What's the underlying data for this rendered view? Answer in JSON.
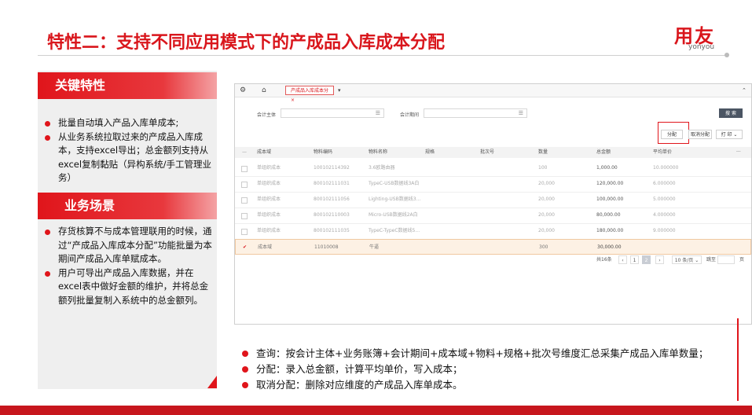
{
  "slide": {
    "title": "特性二：支持不同应用模式下的产成品入库成本分配",
    "logo_cn": "用友",
    "logo_en": "yonyou"
  },
  "key_features": {
    "header": "关键特性",
    "items": [
      "批量自动填入产品入库单成本;",
      "从业务系统拉取过来的产成品入库成本，支持excel导出；总金额列支持从excel复制黏贴（异构系统/手工管理业务）"
    ]
  },
  "scenario": {
    "header": "业务场景",
    "items": [
      "存货核算不与成本管理联用的时候，通过“产成品入库成本分配”功能批量为本期间产成品入库单赋成本。",
      "用户可导出产成品入库数据，并在excel表中做好金额的维护，并将总金额列批量复制入系统中的总金额列。"
    ]
  },
  "app": {
    "tab_label": "产成品入库成本分 ×",
    "filter": {
      "entity_label": "会计主体",
      "period_label": "会计期间",
      "search_button": "搜 索"
    },
    "toolbar": {
      "allocate": "分配",
      "cancel_allocate": "取消分配",
      "print": "打 印"
    },
    "columns": [
      "成本域",
      "物料编码",
      "物料名称",
      "规格",
      "批次号",
      "数量",
      "总金额",
      "平均单价",
      "···"
    ],
    "rows": [
      {
        "domain": "单组织成本",
        "code": "100102114392",
        "name": "3.6欧路由器",
        "qty": "100",
        "amount": "1,000.00",
        "avg": "10.000000",
        "selected": false
      },
      {
        "domain": "单组织成本",
        "code": "800102111031",
        "name": "TypeC-USB数据线3A白",
        "qty": "20,000",
        "amount": "120,000.00",
        "avg": "6.000000",
        "selected": false
      },
      {
        "domain": "单组织成本",
        "code": "800102111056",
        "name": "Lighting-USB数据线3...",
        "qty": "20,000",
        "amount": "100,000.00",
        "avg": "5.000000",
        "selected": false
      },
      {
        "domain": "单组织成本",
        "code": "800102110003",
        "name": "Micro-USB数据线2A白",
        "qty": "20,000",
        "amount": "80,000.00",
        "avg": "4.000000",
        "selected": false
      },
      {
        "domain": "单组织成本",
        "code": "800102111035",
        "name": "TypeC-TypeC数据线5...",
        "qty": "20,000",
        "amount": "180,000.00",
        "avg": "9.000000",
        "selected": false
      },
      {
        "domain": "成本域",
        "code": "11010008",
        "name": "牛逼",
        "qty": "300",
        "amount": "30,000.00",
        "avg": "",
        "selected": true
      }
    ],
    "pager": {
      "total": "共16条",
      "page1": "1",
      "page2": "2",
      "page_size": "10 条/页",
      "goto_label": "跳至",
      "page_unit": "页"
    }
  },
  "notes": [
    "查询：按会计主体+业务账簿+会计期间+成本域+物料+规格+批次号维度汇总采集产成品入库单数量；",
    "分配：录入总金额，计算平均单价，写入成本；",
    "取消分配：删除对应维度的产成品入库单成本。"
  ],
  "colors": {
    "brand_red": "#d9161c"
  }
}
